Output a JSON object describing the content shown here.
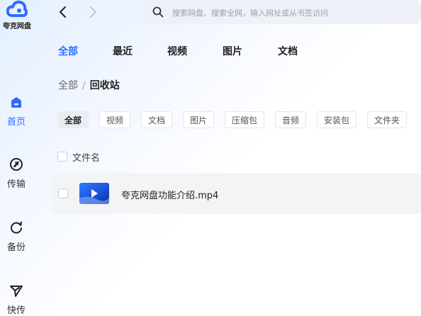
{
  "app": {
    "name": "夸克网盘",
    "brand_color": "#2f6cff"
  },
  "sidebar": {
    "items": [
      {
        "label": "首页",
        "icon": "home-icon",
        "active": true
      },
      {
        "label": "传输",
        "icon": "transfer-icon",
        "active": false
      },
      {
        "label": "备份",
        "icon": "backup-icon",
        "active": false
      },
      {
        "label": "快传",
        "icon": "quick-send-icon",
        "active": false
      }
    ]
  },
  "toolbar": {
    "back_icon": "chevron-left-icon",
    "forward_icon": "chevron-right-icon",
    "search": {
      "placeholder": "搜索网盘、搜索全网，输入网址或从书签访问",
      "value": "",
      "icon": "search-icon"
    }
  },
  "tabs": [
    {
      "label": "全部",
      "active": true
    },
    {
      "label": "最近",
      "active": false
    },
    {
      "label": "视频",
      "active": false
    },
    {
      "label": "图片",
      "active": false
    },
    {
      "label": "文档",
      "active": false
    }
  ],
  "breadcrumb": {
    "root": "全部",
    "separator": "/",
    "current": "回收站"
  },
  "filters": [
    {
      "label": "全部",
      "active": true
    },
    {
      "label": "视频",
      "active": false
    },
    {
      "label": "文档",
      "active": false
    },
    {
      "label": "图片",
      "active": false
    },
    {
      "label": "压缩包",
      "active": false
    },
    {
      "label": "音频",
      "active": false
    },
    {
      "label": "安装包",
      "active": false
    },
    {
      "label": "文件夹",
      "active": false
    }
  ],
  "file_list": {
    "header": {
      "name_column": "文件名"
    },
    "rows": [
      {
        "name": "夸克网盘功能介绍.mp4",
        "type": "video",
        "icon": "video-thumbnail-icon",
        "selected": false
      }
    ]
  }
}
